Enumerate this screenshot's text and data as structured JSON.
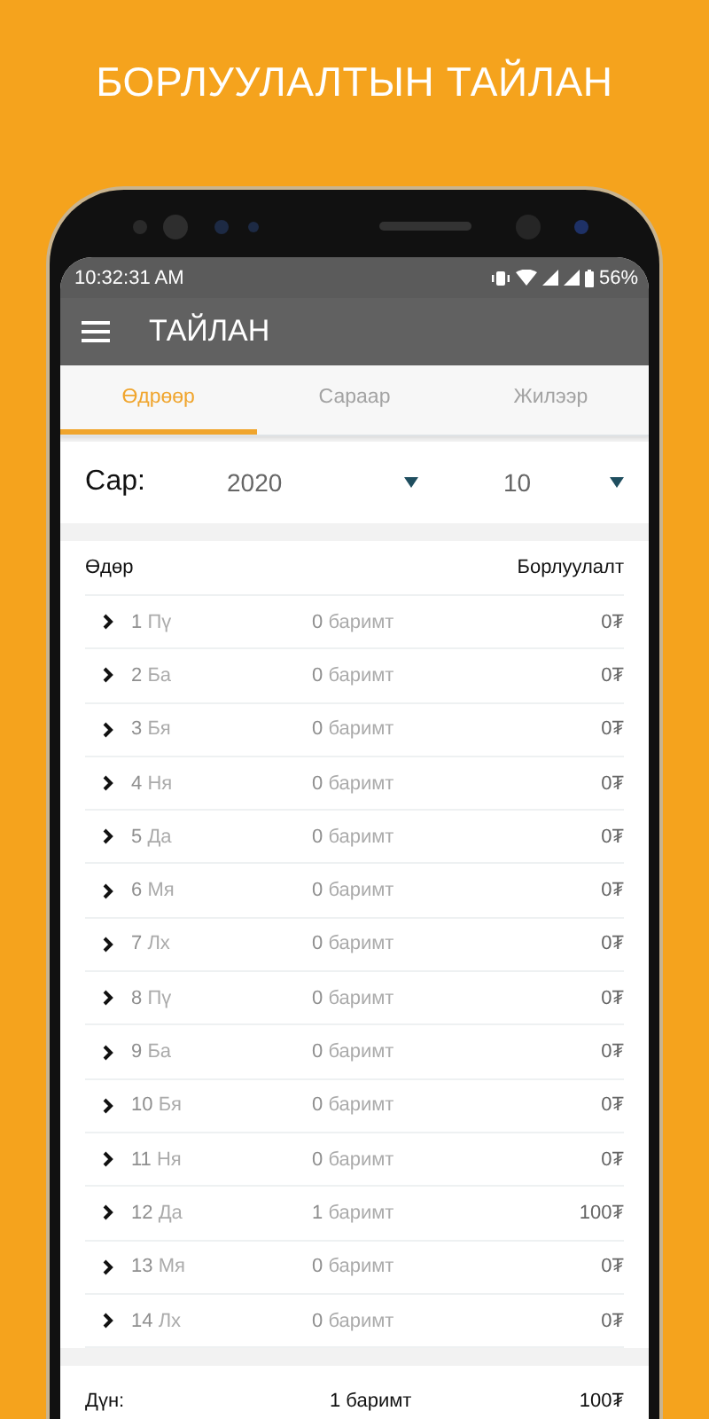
{
  "headline": "БОРЛУУЛАЛТЫН ТАЙЛАН",
  "status_bar": {
    "time": "10:32:31 AM",
    "battery": "56%"
  },
  "app_bar": {
    "title": "ТАЙЛАН"
  },
  "tabs": [
    {
      "label": "Өдрөөр",
      "selected": true
    },
    {
      "label": "Сараар",
      "selected": false
    },
    {
      "label": "Жилээр",
      "selected": false
    }
  ],
  "filter": {
    "label": "Сар:",
    "year": "2020",
    "month": "10"
  },
  "table": {
    "columns": [
      "Өдөр",
      "Борлуулалт"
    ],
    "rows": [
      {
        "day": "1",
        "weekday": "Пү",
        "count": "0",
        "unit": "баримт",
        "amount": "0₮"
      },
      {
        "day": "2",
        "weekday": "Ба",
        "count": "0",
        "unit": "баримт",
        "amount": "0₮"
      },
      {
        "day": "3",
        "weekday": "Бя",
        "count": "0",
        "unit": "баримт",
        "amount": "0₮"
      },
      {
        "day": "4",
        "weekday": "Ня",
        "count": "0",
        "unit": "баримт",
        "amount": "0₮"
      },
      {
        "day": "5",
        "weekday": "Да",
        "count": "0",
        "unit": "баримт",
        "amount": "0₮"
      },
      {
        "day": "6",
        "weekday": "Мя",
        "count": "0",
        "unit": "баримт",
        "amount": "0₮"
      },
      {
        "day": "7",
        "weekday": "Лх",
        "count": "0",
        "unit": "баримт",
        "amount": "0₮"
      },
      {
        "day": "8",
        "weekday": "Пү",
        "count": "0",
        "unit": "баримт",
        "amount": "0₮"
      },
      {
        "day": "9",
        "weekday": "Ба",
        "count": "0",
        "unit": "баримт",
        "amount": "0₮"
      },
      {
        "day": "10",
        "weekday": "Бя",
        "count": "0",
        "unit": "баримт",
        "amount": "0₮"
      },
      {
        "day": "11",
        "weekday": "Ня",
        "count": "0",
        "unit": "баримт",
        "amount": "0₮"
      },
      {
        "day": "12",
        "weekday": "Да",
        "count": "1",
        "unit": "баримт",
        "amount": "100₮"
      },
      {
        "day": "13",
        "weekday": "Мя",
        "count": "0",
        "unit": "баримт",
        "amount": "0₮"
      },
      {
        "day": "14",
        "weekday": "Лх",
        "count": "0",
        "unit": "баримт",
        "amount": "0₮"
      }
    ]
  },
  "total": {
    "label": "Дүн:",
    "count": "1 баримт",
    "amount": "100₮"
  }
}
